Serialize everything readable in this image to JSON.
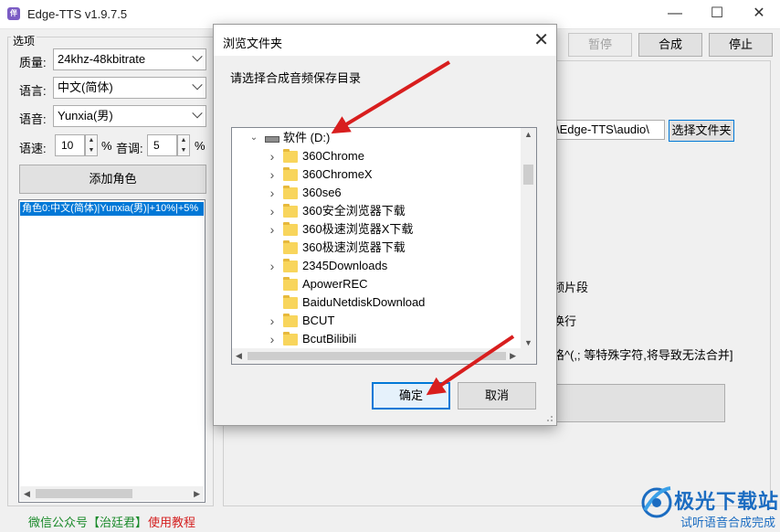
{
  "window": {
    "title": "Edge-TTS v1.9.7.5",
    "icon_text": "伴",
    "minimize": "—",
    "maximize": "☐",
    "close": "✕"
  },
  "options": {
    "group_title": "选项",
    "quality_label": "质量:",
    "quality_value": "24khz-48kbitrate",
    "language_label": "语言:",
    "language_value": "中文(简体)",
    "voice_label": "语音:",
    "voice_value": "Yunxia(男)",
    "speed_label": "语速:",
    "speed_value": "10",
    "speed_unit": "%",
    "pitch_label": "音调:",
    "pitch_value": "5",
    "pitch_unit": "%",
    "add_role_button": "添加角色",
    "roles": [
      "角色0:中文(简体)|Yunxia(男)|+10%|+5%"
    ]
  },
  "toolbar": {
    "pause": "暂停",
    "synthesize": "合成",
    "stop": "停止"
  },
  "right_panel": {
    "output_path": "\\Edge-TTS\\audio\\",
    "choose_folder_button": "选择文件夹",
    "partial_text_1": "频片段",
    "partial_text_2": "换行",
    "partial_text_3": "格^(,; 等特殊字符,将导致无法合并]"
  },
  "footer": {
    "wechat": "微信公众号【治廷君】",
    "tutorial": "使用教程"
  },
  "watermark": {
    "brand": "极光下载站",
    "sub": "试听语音合成完成"
  },
  "dialog": {
    "title": "浏览文件夹",
    "close": "✕",
    "prompt": "请选择合成音频保存目录",
    "root": "软件 (D:)",
    "folders": [
      {
        "name": "360Chrome",
        "expandable": true
      },
      {
        "name": "360ChromeX",
        "expandable": true
      },
      {
        "name": "360se6",
        "expandable": true
      },
      {
        "name": "360安全浏览器下载",
        "expandable": true
      },
      {
        "name": "360极速浏览器X下载",
        "expandable": true
      },
      {
        "name": "360极速浏览器下载",
        "expandable": false
      },
      {
        "name": "2345Downloads",
        "expandable": true
      },
      {
        "name": "ApowerREC",
        "expandable": false
      },
      {
        "name": "BaiduNetdiskDownload",
        "expandable": false
      },
      {
        "name": "BCUT",
        "expandable": true
      },
      {
        "name": "BcutBilibili",
        "expandable": true
      }
    ],
    "ok": "确定",
    "cancel": "取消"
  },
  "colors": {
    "selection": "#0078d7",
    "annotation_arrow": "#d81e1e",
    "footer_green": "#1a8a2a",
    "footer_red": "#d42020"
  }
}
